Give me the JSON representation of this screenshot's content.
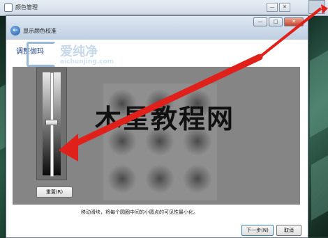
{
  "background_window": {
    "title": "颜色管理",
    "controls": [
      "—",
      "□",
      "✕"
    ]
  },
  "window": {
    "title": "显示颜色校准",
    "back_label": "←",
    "controls": [
      "—",
      "□",
      "✕"
    ],
    "heading": "调整伽玛"
  },
  "watermark": {
    "logo_cn": "爱纯净",
    "logo_url": "aichunjing.com",
    "overlay_text": "木星教程网"
  },
  "slider": {
    "value_fraction": 0.48
  },
  "buttons": {
    "reset": "重置(R)",
    "next": "下一步(N)",
    "cancel": "取消"
  },
  "instruction": "移动滑块，将每个圆圈中间的小圆点的可见性最小化。",
  "colors": {
    "arrow": "#e0211b",
    "heading": "#1c3f7a",
    "panel_gray": "#858585"
  }
}
